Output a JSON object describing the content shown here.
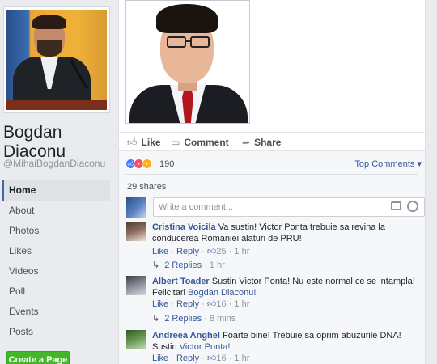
{
  "page": {
    "name": "Bogdan Diaconu",
    "handle": "@MihaiBogdanDiaconu",
    "nav": [
      "Home",
      "About",
      "Photos",
      "Likes",
      "Videos",
      "Poll",
      "Events",
      "Posts"
    ],
    "create_page": "Create a Page"
  },
  "post": {
    "actions": {
      "like": "Like",
      "comment": "Comment",
      "share": "Share"
    },
    "reactions_count": "190",
    "top_comments": "Top Comments",
    "shares": "29 shares",
    "write_placeholder": "Write a comment..."
  },
  "comments": [
    {
      "author": "Cristina Voicila",
      "text": " Va sustin! Victor Ponta trebuie sa revina la conducerea Romaniei alaturi de PRU!",
      "link": "",
      "like": "Like",
      "reply": "Reply",
      "likes": "25",
      "time": "1 hr",
      "replies": "2 Replies",
      "replies_time": "1 hr"
    },
    {
      "author": "Albert Toader",
      "text": " Sustin Victor Ponta! Nu este normal ce se intampla! Felicitari ",
      "link": "Bogdan Diaconu!",
      "like": "Like",
      "reply": "Reply",
      "likes": "16",
      "time": "1 hr",
      "replies": "2 Replies",
      "replies_time": "8 mins"
    },
    {
      "author": "Andreea Anghel",
      "text": " Foarte bine! Trebuie sa oprim abuzurile DNA! Sustin ",
      "link": "Victor Ponta!",
      "like": "Like",
      "reply": "Reply",
      "likes": "16",
      "time": "1 hr"
    }
  ],
  "colors": {
    "link": "#365899",
    "like_reaction": "#4080ff",
    "angry_reaction": "#f25268",
    "haha_reaction": "#f7b125",
    "create_button": "#42b72a"
  },
  "icons": [
    "thumbs-up-icon",
    "comment-icon",
    "share-icon",
    "camera-icon",
    "smiley-icon",
    "reply-arrow-icon"
  ]
}
